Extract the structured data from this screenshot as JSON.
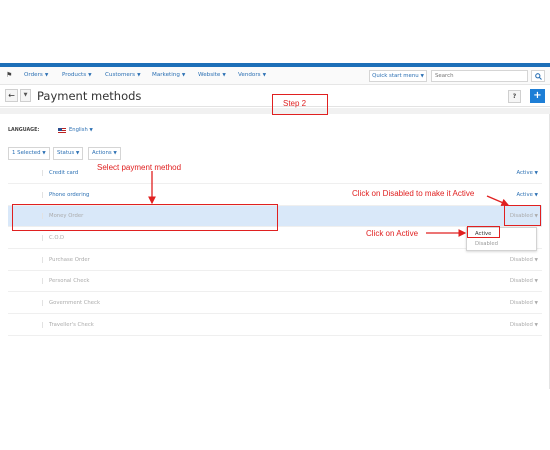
{
  "navbar": {
    "home_icon": "home-icon",
    "items": [
      {
        "label": "Orders"
      },
      {
        "label": "Products"
      },
      {
        "label": "Customers"
      },
      {
        "label": "Marketing"
      },
      {
        "label": "Website"
      },
      {
        "label": "Vendors"
      }
    ],
    "quick_start_label": "Quick start menu",
    "search_placeholder": "Search",
    "search_icon": "search-icon"
  },
  "title_bar": {
    "title": "Payment methods",
    "help_label": "?",
    "add_label": "+"
  },
  "language": {
    "label": "LANGUAGE:",
    "value": "English"
  },
  "toolbar": {
    "selected_label": "1 Selected",
    "status_label": "Status",
    "actions_label": "Actions"
  },
  "payment_methods": [
    {
      "name": "Credit card",
      "status": "Active"
    },
    {
      "name": "Phone ordering",
      "status": "Active"
    },
    {
      "name": "Money Order",
      "status": "Disabled"
    },
    {
      "name": "C.O.D",
      "status": ""
    },
    {
      "name": "Purchase Order",
      "status": "Disabled"
    },
    {
      "name": "Personal Check",
      "status": "Disabled"
    },
    {
      "name": "Government Check",
      "status": "Disabled"
    },
    {
      "name": "Traveller's Check",
      "status": "Disabled"
    }
  ],
  "status_dropdown": {
    "options": [
      "Active",
      "Disabled"
    ]
  },
  "annotations": {
    "step": "Step 2",
    "select_method": "Select payment method",
    "click_disabled": "Click on Disabled to make it Active",
    "click_active": "Click on Active"
  },
  "colors": {
    "accent": "#1d7ed6",
    "link": "#2a6fb3",
    "annotation": "#e02020",
    "selected_row": "#d9e8f9"
  }
}
